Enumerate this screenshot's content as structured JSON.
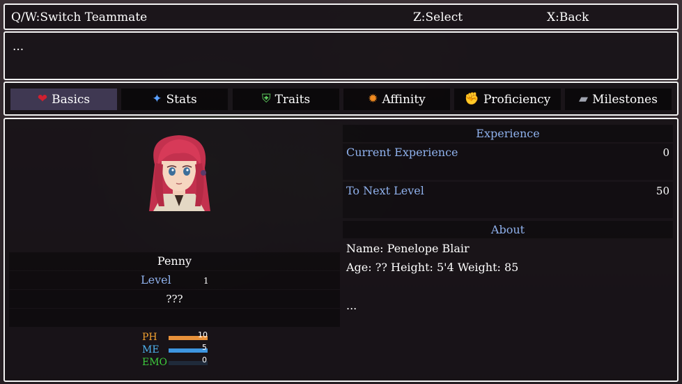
{
  "help": {
    "switch": "Q/W:Switch Teammate",
    "select": "Z:Select",
    "back": "X:Back"
  },
  "message": "...",
  "tabs": [
    {
      "label": "Basics",
      "icon": "heart-icon",
      "glyph": "❤",
      "color": "#d02030"
    },
    {
      "label": "Stats",
      "icon": "sparkle-icon",
      "glyph": "✦",
      "color": "#5aa0ff"
    },
    {
      "label": "Traits",
      "icon": "shield-icon",
      "glyph": "⛨",
      "color": "#5fcf5f"
    },
    {
      "label": "Affinity",
      "icon": "sun-icon",
      "glyph": "✹",
      "color": "#f08a20"
    },
    {
      "label": "Proficiency",
      "icon": "fist-icon",
      "glyph": "✊",
      "color": "#e8e0d0"
    },
    {
      "label": "Milestones",
      "icon": "book-icon",
      "glyph": "▰",
      "color": "#a0a4b0"
    }
  ],
  "character": {
    "name": "Penny",
    "level_label": "Level",
    "level": "1",
    "class": "???",
    "gauges": [
      {
        "label": "PH",
        "value": "10",
        "fraction": 1.0,
        "label_color": "#f0a030",
        "fill": "#e8913a"
      },
      {
        "label": "ME",
        "value": "5",
        "fraction": 1.0,
        "label_color": "#4fb4f0",
        "fill": "#3d95e0"
      },
      {
        "label": "EMO",
        "value": "0",
        "fraction": 0.0,
        "label_color": "#3ecf3e",
        "fill": "#3ecf3e"
      }
    ]
  },
  "experience": {
    "header": "Experience",
    "current_label": "Current Experience",
    "current_value": "0",
    "next_label": "To Next Level",
    "next_value": "50"
  },
  "about": {
    "header": "About",
    "name_line": "Name: Penelope Blair",
    "stats_line": "Age: ??  Height: 5'4  Weight: 85",
    "more": "..."
  }
}
